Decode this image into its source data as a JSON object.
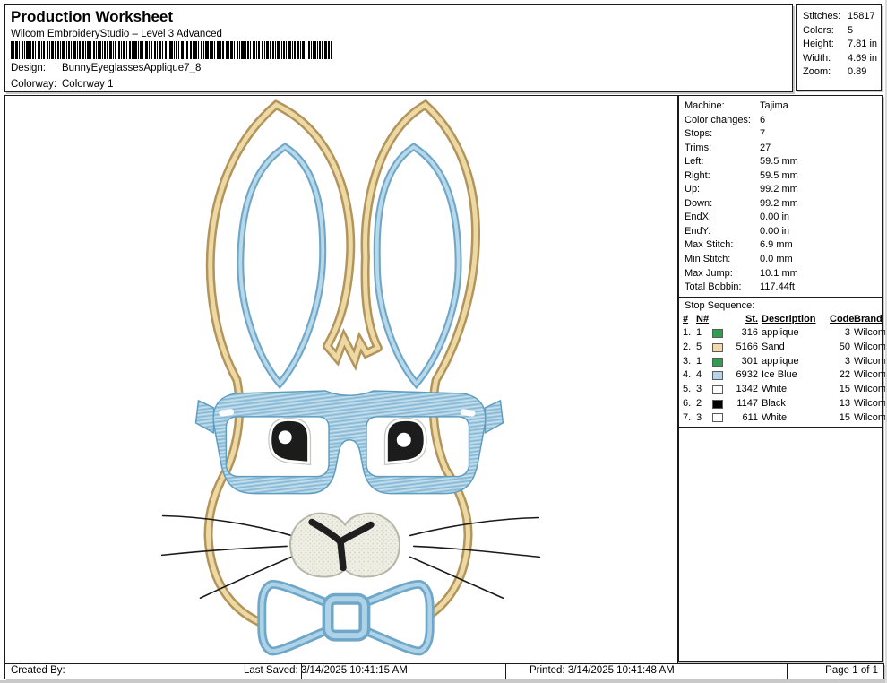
{
  "header": {
    "title": "Production Worksheet",
    "subtitle": "Wilcom EmbroideryStudio – Level 3 Advanced",
    "design_label": "Design:",
    "design_value": "BunnyEyeglassesApplique7_8",
    "colorway_label": "Colorway:",
    "colorway_value": "Colorway 1"
  },
  "summary": {
    "rows": [
      {
        "label": "Stitches:",
        "value": "15817"
      },
      {
        "label": "Colors:",
        "value": "5"
      },
      {
        "label": "Height:",
        "value": "7.81 in"
      },
      {
        "label": "Width:",
        "value": "4.69 in"
      },
      {
        "label": "Zoom:",
        "value": "0.89"
      }
    ]
  },
  "machine": {
    "rows": [
      {
        "label": "Machine:",
        "value": "Tajima"
      },
      {
        "label": "Color changes:",
        "value": "6"
      },
      {
        "label": "Stops:",
        "value": "7"
      },
      {
        "label": "Trims:",
        "value": "27"
      },
      {
        "label": "Left:",
        "value": "59.5 mm"
      },
      {
        "label": "Right:",
        "value": "59.5 mm"
      },
      {
        "label": "Up:",
        "value": "99.2 mm"
      },
      {
        "label": "Down:",
        "value": "99.2 mm"
      },
      {
        "label": "EndX:",
        "value": "0.00 in"
      },
      {
        "label": "EndY:",
        "value": "0.00 in"
      },
      {
        "label": "Max Stitch:",
        "value": "6.9 mm"
      },
      {
        "label": "Min Stitch:",
        "value": "0.0 mm"
      },
      {
        "label": "Max Jump:",
        "value": "10.1 mm"
      },
      {
        "label": "Total Bobbin:",
        "value": "117.44ft"
      }
    ]
  },
  "stop_sequence": {
    "title": "Stop Sequence:",
    "headers": {
      "num": "#",
      "n": "N#",
      "st": "St.",
      "description": "Description",
      "code": "Code",
      "brand": "Brand"
    },
    "rows": [
      {
        "num": "1.",
        "n": "1",
        "swatch": "#2f9e50",
        "st": "316",
        "description": "applique",
        "code": "3",
        "brand": "Wilcom"
      },
      {
        "num": "2.",
        "n": "5",
        "swatch": "#f5d7ad",
        "st": "5166",
        "description": "Sand",
        "code": "50",
        "brand": "Wilcom"
      },
      {
        "num": "3.",
        "n": "1",
        "swatch": "#2f9e50",
        "st": "301",
        "description": "applique",
        "code": "3",
        "brand": "Wilcom"
      },
      {
        "num": "4.",
        "n": "4",
        "swatch": "#b5d4eb",
        "st": "6932",
        "description": "Ice Blue",
        "code": "22",
        "brand": "Wilcom"
      },
      {
        "num": "5.",
        "n": "3",
        "swatch": "#ffffff",
        "st": "1342",
        "description": "White",
        "code": "15",
        "brand": "Wilcom"
      },
      {
        "num": "6.",
        "n": "2",
        "swatch": "#000000",
        "st": "1147",
        "description": "Black",
        "code": "13",
        "brand": "Wilcom"
      },
      {
        "num": "7.",
        "n": "3",
        "swatch": "#ffffff",
        "st": "611",
        "description": "White",
        "code": "15",
        "brand": "Wilcom"
      }
    ]
  },
  "footer": {
    "created_by": "Created By:",
    "last_saved": "Last Saved: 3/14/2025 10:41:15 AM",
    "printed": "Printed: 3/14/2025 10:41:48 AM",
    "page": "Page 1 of 1"
  },
  "design_preview": {
    "subject": "Bunny with eyeglasses and bow tie applique stitch-out",
    "colors": {
      "sand_outline": "#b3945a",
      "sand_highlight": "#ecd9a4",
      "ice_blue_fill": "#a3cbe1",
      "ice_blue_dark": "#6ea7c8",
      "ice_blue_light": "#b9d9ea",
      "eye_black": "#1c1c1c",
      "muzzle_fill": "#f0efe6",
      "whisker": "#1a1a1a"
    }
  }
}
